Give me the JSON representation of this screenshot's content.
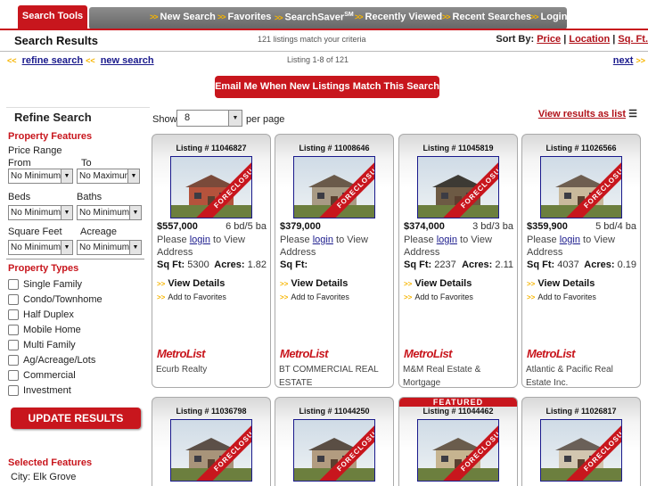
{
  "nav": {
    "search_tools": "Search Tools",
    "items": [
      {
        "label": "New Search"
      },
      {
        "label": "Favorites"
      },
      {
        "label": "SearchSaver",
        "sup": "SM"
      },
      {
        "label": "Recently Viewed"
      },
      {
        "label": "Recent Searches"
      },
      {
        "label": "Login"
      }
    ]
  },
  "results": {
    "title": "Search Results",
    "count_text": "121 listings match your criteria",
    "sort_label": "Sort By:",
    "sort_options": [
      "Price",
      "Location",
      "Sq. Ft."
    ],
    "refine_link": "refine search",
    "new_search_link": "new search",
    "range_text": "Listing 1-8 of 121",
    "next_link": "next"
  },
  "email_button": "Email Me When New Listings Match This Search",
  "sidebar": {
    "refine_title": "Refine Search",
    "property_features": "Property Features",
    "price_range": "Price Range",
    "from": "From",
    "to": "To",
    "from_value": "No Minimum",
    "to_value": "No Maximum",
    "beds": "Beds",
    "baths": "Baths",
    "beds_value": "No Minimum",
    "baths_value": "No Minimum",
    "square_feet": "Square Feet",
    "acreage": "Acreage",
    "sqft_value": "No Minimum",
    "acreage_value": "No Minimum",
    "property_types_title": "Property Types",
    "property_types": [
      "Single Family",
      "Condo/Townhome",
      "Half Duplex",
      "Mobile Home",
      "Multi Family",
      "Ag/Acreage/Lots",
      "Commercial",
      "Investment"
    ],
    "update_button": "UPDATE RESULTS",
    "selected_features_title": "Selected Features",
    "selected_city": "City: Elk Grove"
  },
  "controls": {
    "show_label": "Show",
    "show_value": "8",
    "per_page": "per page",
    "view_list": "View results as list"
  },
  "listings": [
    {
      "number": "Listing # 11046827",
      "price": "$557,000",
      "beds": "6 bd/5 ba",
      "please": "Please",
      "login": "login",
      "to_view": "to View",
      "address_label": "Address",
      "sqft_label": "Sq Ft:",
      "sqft": "5300",
      "acres_label": "Acres:",
      "acres": "1.82",
      "view_details": "View Details",
      "add_fav": "Add to Favorites",
      "broker": "Ecurb Realty",
      "banner": "FORECLOSURE",
      "logo": "MetroList",
      "house_color": "#b5533c",
      "roof_color": "#7a4a3a"
    },
    {
      "number": "Listing # 11008646",
      "price": "$379,000",
      "beds": "",
      "please": "Please",
      "login": "login",
      "to_view": "to View",
      "address_label": "Address",
      "sqft_label": "Sq Ft:",
      "sqft": "",
      "acres_label": "",
      "acres": "",
      "view_details": "View Details",
      "add_fav": "Add to Favorites",
      "broker": "BT COMMERCIAL REAL ESTATE",
      "banner": "FORECLOSURE",
      "logo": "MetroList",
      "house_color": "#a89a84",
      "roof_color": "#6a5a4a"
    },
    {
      "number": "Listing # 11045819",
      "price": "$374,000",
      "beds": "3 bd/3 ba",
      "please": "Please",
      "login": "login",
      "to_view": "to View",
      "address_label": "Address",
      "sqft_label": "Sq Ft:",
      "sqft": "2237",
      "acres_label": "Acres:",
      "acres": "2.11",
      "view_details": "View Details",
      "add_fav": "Add to Favorites",
      "broker": "M&M Real Estate & Mortgage",
      "banner": "FORECLOSURE",
      "logo": "MetroList",
      "house_color": "#6d5a44",
      "roof_color": "#3d3a34"
    },
    {
      "number": "Listing # 11026566",
      "price": "$359,900",
      "beds": "5 bd/4 ba",
      "please": "Please",
      "login": "login",
      "to_view": "to View",
      "address_label": "Address",
      "sqft_label": "Sq Ft:",
      "sqft": "4037",
      "acres_label": "Acres:",
      "acres": "0.19",
      "view_details": "View Details",
      "add_fav": "Add to Favorites",
      "broker": "Atlantic & Pacific Real Estate Inc.",
      "banner": "FORECLOSURE",
      "logo": "MetroList",
      "house_color": "#c9b99c",
      "roof_color": "#6e5e50"
    },
    {
      "number": "Listing # 11036798",
      "banner": "FORECLOSURE",
      "house_color": "#a8947a",
      "roof_color": "#5c5048",
      "featured": ""
    },
    {
      "number": "Listing # 11044250",
      "banner": "FORECLOSURE",
      "house_color": "#b29c80",
      "roof_color": "#5a4e44",
      "featured": ""
    },
    {
      "number": "Listing # 11044462",
      "banner": "FORECLOSURE",
      "house_color": "#c6b490",
      "roof_color": "#6a5c4c",
      "featured": "FEATURED"
    },
    {
      "number": "Listing # 11026817",
      "banner": "FORECLOSURE",
      "house_color": "#d2c6b0",
      "roof_color": "#6a6058",
      "featured": ""
    }
  ]
}
